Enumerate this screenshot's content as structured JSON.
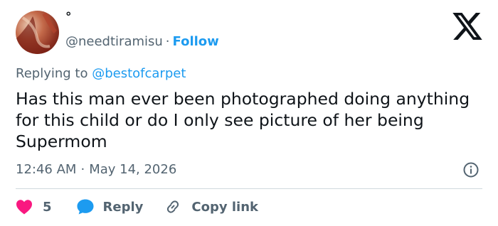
{
  "author": {
    "display_name": "°",
    "handle": "@needtiramisu",
    "separator": "·",
    "follow_label": "Follow"
  },
  "reply_context": {
    "prefix": "Replying to ",
    "target": "@bestofcarpet"
  },
  "tweet": {
    "text": "Has this man ever been photographed doing anything for this child or do I only see picture of her being Supermom"
  },
  "meta": {
    "time": "12:46 AM",
    "separator": "·",
    "date": "May 14, 2026"
  },
  "actions": {
    "like_count": "5",
    "reply_label": "Reply",
    "copy_label": "Copy link"
  },
  "icons": {
    "brand": "x-logo-icon",
    "info": "info-icon",
    "like": "heart-icon",
    "reply": "speech-bubble-icon",
    "copy": "link-icon"
  },
  "colors": {
    "accent": "#1d9bf0",
    "like": "#f91880",
    "text": "#0f1419",
    "secondary": "#536471"
  }
}
